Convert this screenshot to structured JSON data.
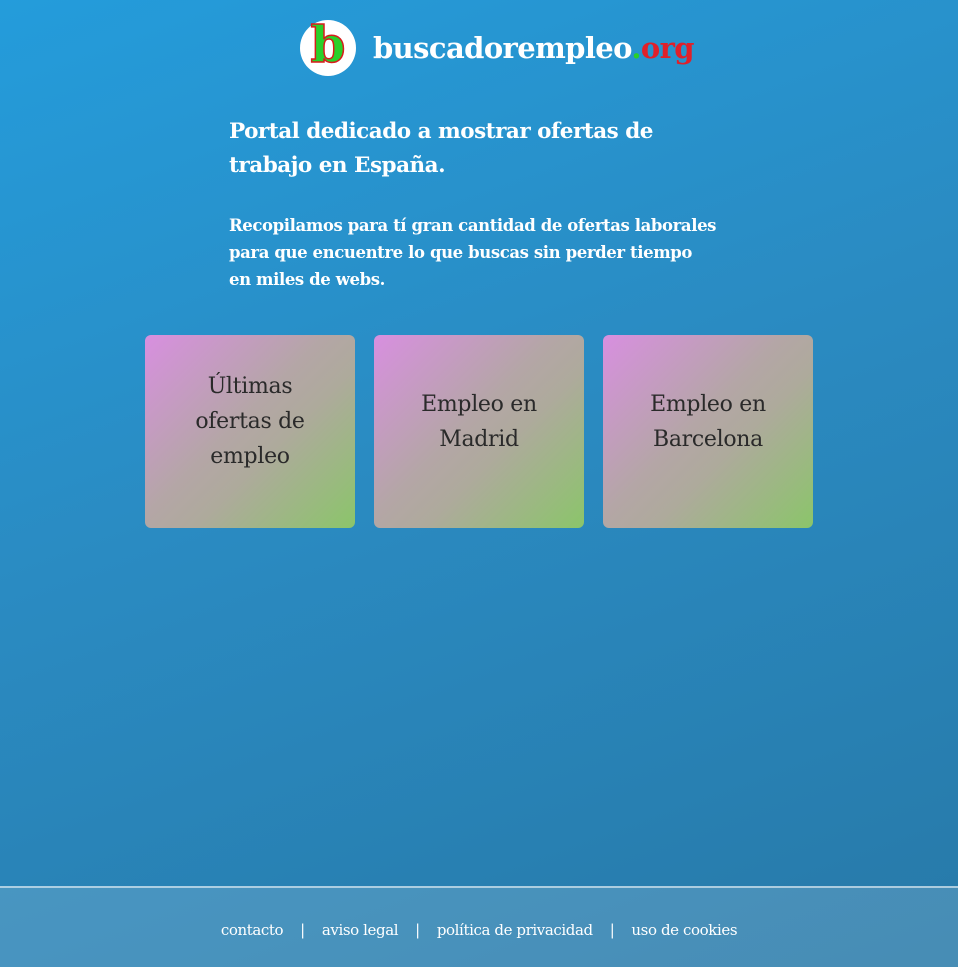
{
  "header": {
    "logo_letter": "b",
    "site_name": "buscadorempleo",
    "site_dot": ".",
    "site_tld": "org"
  },
  "intro": {
    "tagline": "Portal dedicado a mostrar ofertas de trabajo en España.",
    "description": "Recopilamos para tí gran cantidad de ofertas laborales para que encuentre lo que buscas sin perder tiempo en miles de webs."
  },
  "cards": [
    {
      "label": "Últimas ofertas de empleo"
    },
    {
      "label": "Empleo en Madrid"
    },
    {
      "label": "Empleo en Barcelona"
    }
  ],
  "footer": {
    "links": [
      {
        "label": "contacto"
      },
      {
        "label": "aviso legal"
      },
      {
        "label": "política de privacidad"
      },
      {
        "label": "uso de cookies"
      }
    ],
    "separator": "|"
  },
  "colors": {
    "background": "#2a8bc2",
    "logo_green": "#2ad02a",
    "logo_red": "#e0202a",
    "card_gradient_start": "#d88fe0",
    "card_gradient_end": "#8bc56a"
  },
  "icons": {
    "logo": "b-logo-icon"
  }
}
